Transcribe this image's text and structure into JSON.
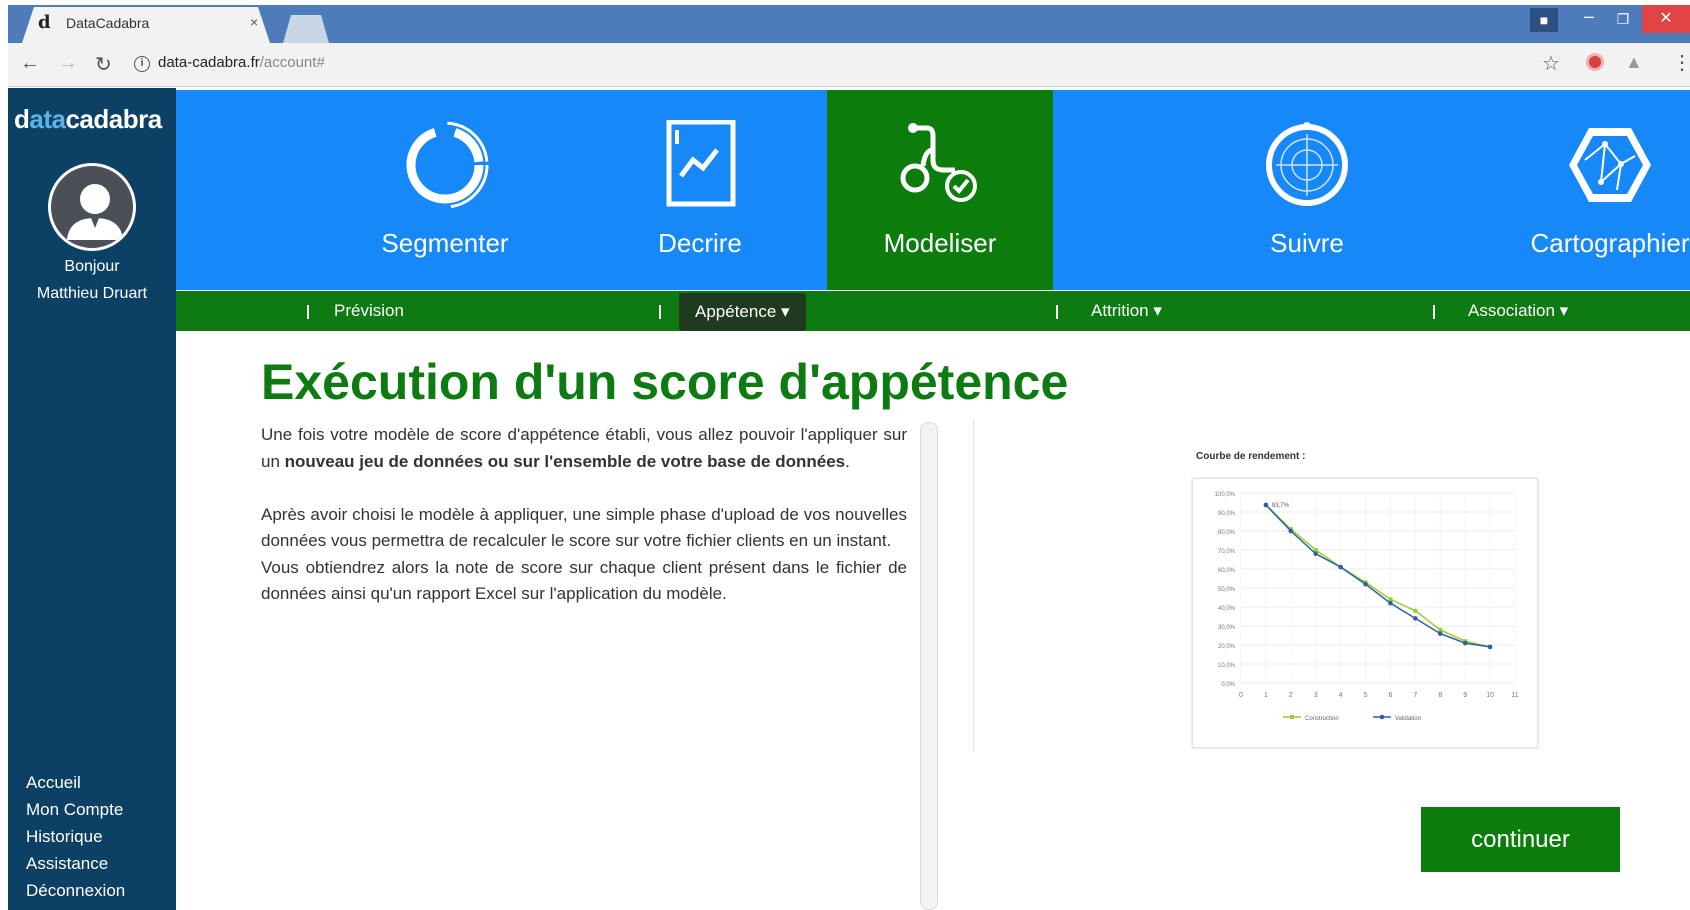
{
  "browser": {
    "tab_title": "DataCadabra",
    "tab_close": "×",
    "tab_favicon": "d",
    "url_host": "data-cadabra.fr",
    "url_path": "/account#",
    "icons": [
      "back-icon",
      "forward-icon",
      "reload-icon",
      "info-icon",
      "star-icon",
      "extension-icon",
      "menu-icon"
    ]
  },
  "sidebar": {
    "logo_prefix": "d",
    "logo_highlight": "ata",
    "logo_suffix": "cadabra",
    "greeting": "Bonjour",
    "user_name": "Matthieu Druart",
    "links": [
      {
        "label": "Accueil"
      },
      {
        "label": "Mon Compte"
      },
      {
        "label": "Historique"
      },
      {
        "label": "Assistance"
      },
      {
        "label": "Déconnexion"
      }
    ]
  },
  "modules": [
    {
      "label": "Segmenter",
      "icon": "segment-ring-icon"
    },
    {
      "label": "Decrire",
      "icon": "chart-document-icon"
    },
    {
      "label": "Modeliser",
      "icon": "stethoscope-check-icon"
    },
    {
      "label": "Suivre",
      "icon": "radar-icon"
    },
    {
      "label": "Cartographier",
      "icon": "hexagon-map-icon"
    }
  ],
  "submenu": {
    "prevision": "Prévision",
    "appetence": "Appétence ▾",
    "attrition": "Attrition ▾",
    "association": "Association ▾"
  },
  "content": {
    "title": "Exécution d'un score d'appétence",
    "p1_start": "Une fois votre modèle de score d'appétence établi, vous allez pouvoir l'appliquer sur un ",
    "p1_bold": "nouveau jeu de données ou sur l'ensemble de votre base de données",
    "p1_end": ".",
    "p2": "Après avoir choisi le modèle à appliquer, une simple phase d'upload de vos nouvelles données vous permettra de recalculer le score sur votre fichier clients en un instant.",
    "p3": "Vous obtiendrez alors la note de score sur chaque client présent dans le fichier de données ainsi qu'un rapport Excel sur l'application du modèle.",
    "continue_label": "continuer"
  },
  "colors": {
    "sidebar": "#0c4064",
    "module_bar": "#1788f7",
    "active_green": "#0c7c0c",
    "title_green": "#0d7a12"
  },
  "chart_data": {
    "type": "line",
    "title": "Courbe de rendement :",
    "x": [
      1,
      2,
      3,
      4,
      5,
      6,
      7,
      8,
      9,
      10
    ],
    "x_ticks": [
      0,
      1,
      2,
      3,
      4,
      5,
      6,
      7,
      8,
      9,
      10,
      11
    ],
    "y_ticks": [
      "100,0%",
      "90,0%",
      "80,0%",
      "70,0%",
      "60,0%",
      "50,0%",
      "40,0%",
      "30,0%",
      "20,0%",
      "10,0%",
      "0,0%"
    ],
    "ylim": [
      0,
      100
    ],
    "annotation": "93,7%",
    "series": [
      {
        "name": "Construction",
        "color": "#9acd32",
        "values": [
          93.7,
          81,
          70,
          61,
          53,
          44,
          38,
          28,
          22,
          19
        ]
      },
      {
        "name": "Validation",
        "color": "#2e5fa8",
        "values": [
          93.7,
          80,
          68,
          61,
          52,
          42,
          34,
          26,
          21,
          19
        ]
      }
    ]
  }
}
